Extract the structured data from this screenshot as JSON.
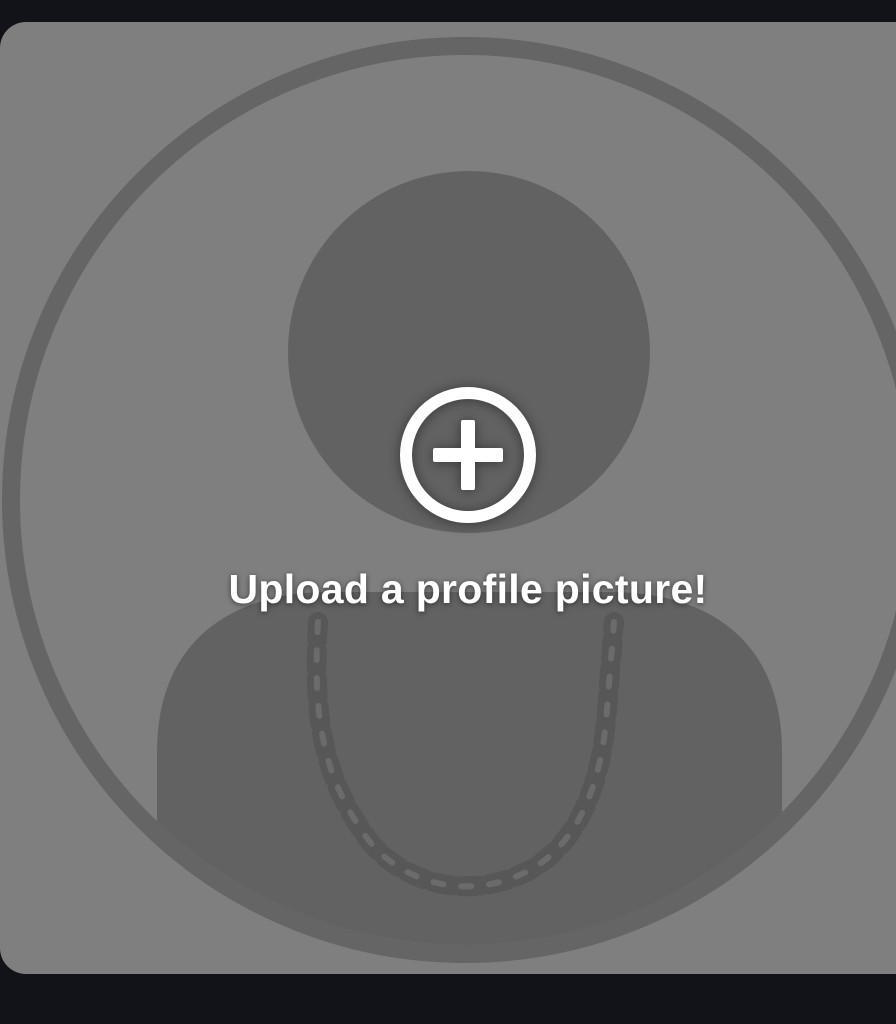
{
  "upload": {
    "label": "Upload a profile picture!",
    "icon": "plus-circle-icon"
  },
  "placeholder": {
    "icon": "default-avatar-icon",
    "accessory_icon": "gold-chain-icon"
  },
  "colors": {
    "app_background": "#121318",
    "card_background": "#7f7f7f",
    "avatar_shape": "#616161",
    "icon_color": "#ffffff"
  }
}
